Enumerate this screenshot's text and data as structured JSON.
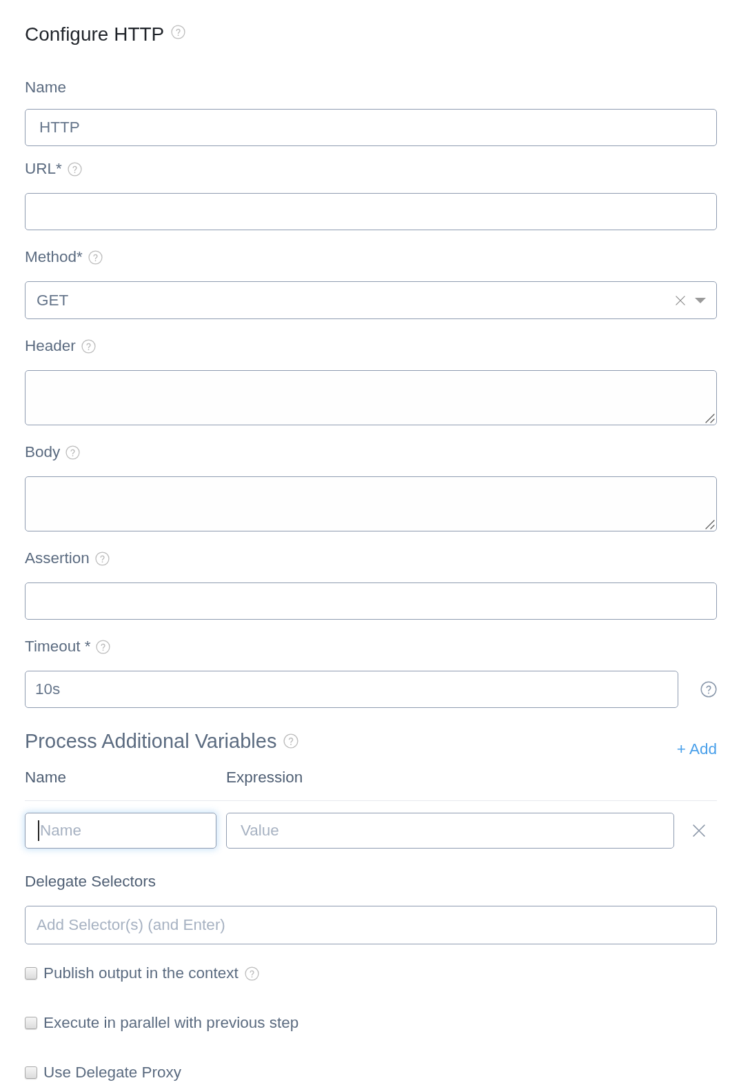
{
  "title": {
    "text": "Configure HTTP",
    "help": true
  },
  "fields": [
    {
      "kind": "input",
      "label": "Name",
      "help": false,
      "value": "HTTP",
      "trailing_help": false
    },
    {
      "kind": "input",
      "label": "URL*",
      "help": true,
      "trailing_help": false
    },
    {
      "kind": "select",
      "label": "Method*",
      "help": true,
      "value": "GET",
      "trailing_help": false
    },
    {
      "kind": "textarea",
      "label": "Header",
      "help": true,
      "trailing_help": false
    },
    {
      "kind": "textarea",
      "label": "Body",
      "help": true,
      "trailing_help": false
    },
    {
      "kind": "input",
      "label": "Assertion",
      "help": true,
      "trailing_help": false
    },
    {
      "kind": "input",
      "label": "Timeout *",
      "help": true,
      "value": "10s",
      "trailing_help": true
    }
  ],
  "variables": {
    "title": "Process Additional Variables",
    "help": true,
    "add_label": "+ Add",
    "columns": [
      "Name",
      "Expression"
    ],
    "rows": [
      {
        "name": {
          "placeholder": "Name",
          "focused": true
        },
        "expression": {
          "placeholder": "Value",
          "focused": false
        }
      }
    ]
  },
  "delegate_selectors": {
    "label": "Delegate Selectors",
    "placeholder": "Add Selector(s) (and Enter)"
  },
  "options": [
    {
      "label": "Publish output in the context",
      "checked": false,
      "help": true
    },
    {
      "label": "Execute in parallel with previous step",
      "checked": false,
      "help": false
    },
    {
      "label": "Use Delegate Proxy",
      "checked": false,
      "help": false
    }
  ]
}
